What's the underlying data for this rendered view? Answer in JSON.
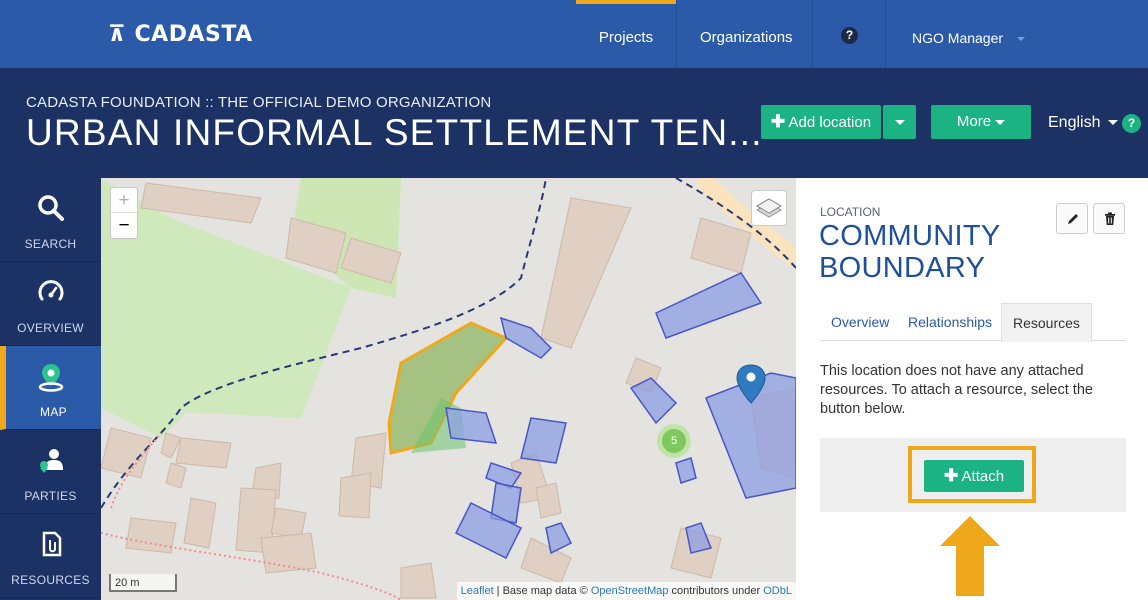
{
  "nav": {
    "logo": "⊼ CADASTA",
    "items": [
      {
        "label": "Projects"
      },
      {
        "label": "Organizations"
      }
    ],
    "help_glyph": "?",
    "user": "NGO Manager"
  },
  "header": {
    "breadcrumb": "CADASTA FOUNDATION :: THE OFFICIAL DEMO ORGANIZATION",
    "title": "URBAN INFORMAL SETTLEMENT TEN...",
    "add_location_label": "Add location",
    "more_label": "More",
    "language": "English",
    "lang_help_glyph": "?"
  },
  "sidebar": {
    "items": [
      {
        "label": "SEARCH",
        "icon": "search-icon"
      },
      {
        "label": "OVERVIEW",
        "icon": "dashboard-icon"
      },
      {
        "label": "MAP",
        "icon": "map-pin-icon"
      },
      {
        "label": "PARTIES",
        "icon": "parties-icon"
      },
      {
        "label": "RESOURCES",
        "icon": "resources-icon"
      }
    ]
  },
  "map": {
    "zoom_in": "+",
    "zoom_out": "−",
    "scale": "20 m",
    "cluster_count": "5",
    "attribution": {
      "leaflet": "Leaflet",
      "base": " | Base map data © ",
      "osm": "OpenStreetMap",
      "contributors": " contributors under ",
      "odbl": "ODbL"
    }
  },
  "panel": {
    "label": "LOCATION",
    "title": "COMMUNITY BOUNDARY",
    "tabs": [
      {
        "label": "Overview"
      },
      {
        "label": "Relationships"
      },
      {
        "label": "Resources"
      }
    ],
    "empty_text": "This location does not have any attached resources. To attach a resource, select the button below.",
    "attach_label": "Attach"
  },
  "colors": {
    "brand_blue": "#2b5aa8",
    "header_navy": "#1c3264",
    "accent_green": "#1cb382",
    "highlight_orange": "#f0a81b"
  }
}
